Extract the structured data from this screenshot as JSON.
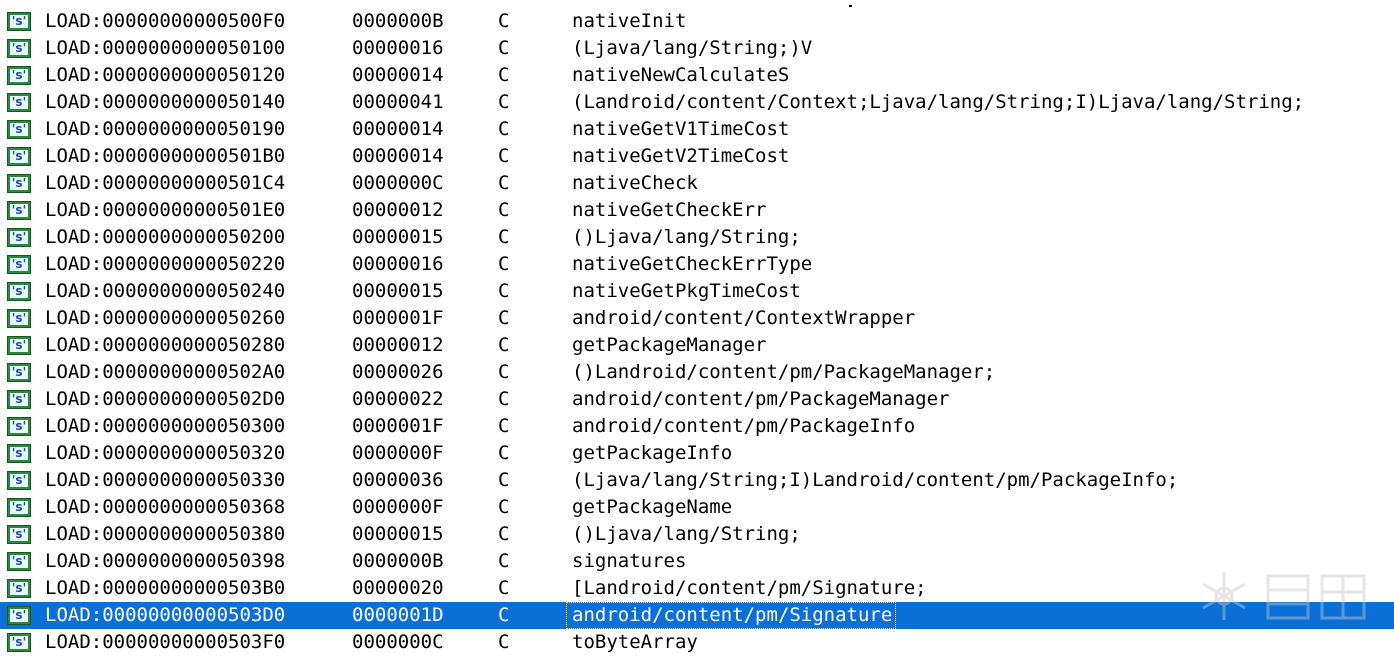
{
  "icon_glyph": "'s'",
  "rows": [
    {
      "address": "LOAD:00000000000500F0",
      "length": "0000000B",
      "type": "C",
      "value": "nativeInit"
    },
    {
      "address": "LOAD:0000000000050100",
      "length": "00000016",
      "type": "C",
      "value": "(Ljava/lang/String;)V"
    },
    {
      "address": "LOAD:0000000000050120",
      "length": "00000014",
      "type": "C",
      "value": "nativeNewCalculateS"
    },
    {
      "address": "LOAD:0000000000050140",
      "length": "00000041",
      "type": "C",
      "value": "(Landroid/content/Context;Ljava/lang/String;I)Ljava/lang/String;"
    },
    {
      "address": "LOAD:0000000000050190",
      "length": "00000014",
      "type": "C",
      "value": "nativeGetV1TimeCost"
    },
    {
      "address": "LOAD:00000000000501B0",
      "length": "00000014",
      "type": "C",
      "value": "nativeGetV2TimeCost"
    },
    {
      "address": "LOAD:00000000000501C4",
      "length": "0000000C",
      "type": "C",
      "value": "nativeCheck"
    },
    {
      "address": "LOAD:00000000000501E0",
      "length": "00000012",
      "type": "C",
      "value": "nativeGetCheckErr"
    },
    {
      "address": "LOAD:0000000000050200",
      "length": "00000015",
      "type": "C",
      "value": "()Ljava/lang/String;"
    },
    {
      "address": "LOAD:0000000000050220",
      "length": "00000016",
      "type": "C",
      "value": "nativeGetCheckErrType"
    },
    {
      "address": "LOAD:0000000000050240",
      "length": "00000015",
      "type": "C",
      "value": "nativeGetPkgTimeCost"
    },
    {
      "address": "LOAD:0000000000050260",
      "length": "0000001F",
      "type": "C",
      "value": "android/content/ContextWrapper"
    },
    {
      "address": "LOAD:0000000000050280",
      "length": "00000012",
      "type": "C",
      "value": "getPackageManager"
    },
    {
      "address": "LOAD:00000000000502A0",
      "length": "00000026",
      "type": "C",
      "value": "()Landroid/content/pm/PackageManager;"
    },
    {
      "address": "LOAD:00000000000502D0",
      "length": "00000022",
      "type": "C",
      "value": "android/content/pm/PackageManager"
    },
    {
      "address": "LOAD:0000000000050300",
      "length": "0000001F",
      "type": "C",
      "value": "android/content/pm/PackageInfo"
    },
    {
      "address": "LOAD:0000000000050320",
      "length": "0000000F",
      "type": "C",
      "value": "getPackageInfo"
    },
    {
      "address": "LOAD:0000000000050330",
      "length": "00000036",
      "type": "C",
      "value": "(Ljava/lang/String;I)Landroid/content/pm/PackageInfo;"
    },
    {
      "address": "LOAD:0000000000050368",
      "length": "0000000F",
      "type": "C",
      "value": "getPackageName"
    },
    {
      "address": "LOAD:0000000000050380",
      "length": "00000015",
      "type": "C",
      "value": "()Ljava/lang/String;"
    },
    {
      "address": "LOAD:0000000000050398",
      "length": "0000000B",
      "type": "C",
      "value": "signatures"
    },
    {
      "address": "LOAD:00000000000503B0",
      "length": "00000020",
      "type": "C",
      "value": "[Landroid/content/pm/Signature;"
    },
    {
      "address": "LOAD:00000000000503D0",
      "length": "0000001D",
      "type": "C",
      "value": "android/content/pm/Signature",
      "selected": true
    },
    {
      "address": "LOAD:00000000000503F0",
      "length": "0000000C",
      "type": "C",
      "value": "toByteArray"
    }
  ],
  "selection_color": "#0a6fd6",
  "watermark_icon": "kanxue-watermark-icon"
}
